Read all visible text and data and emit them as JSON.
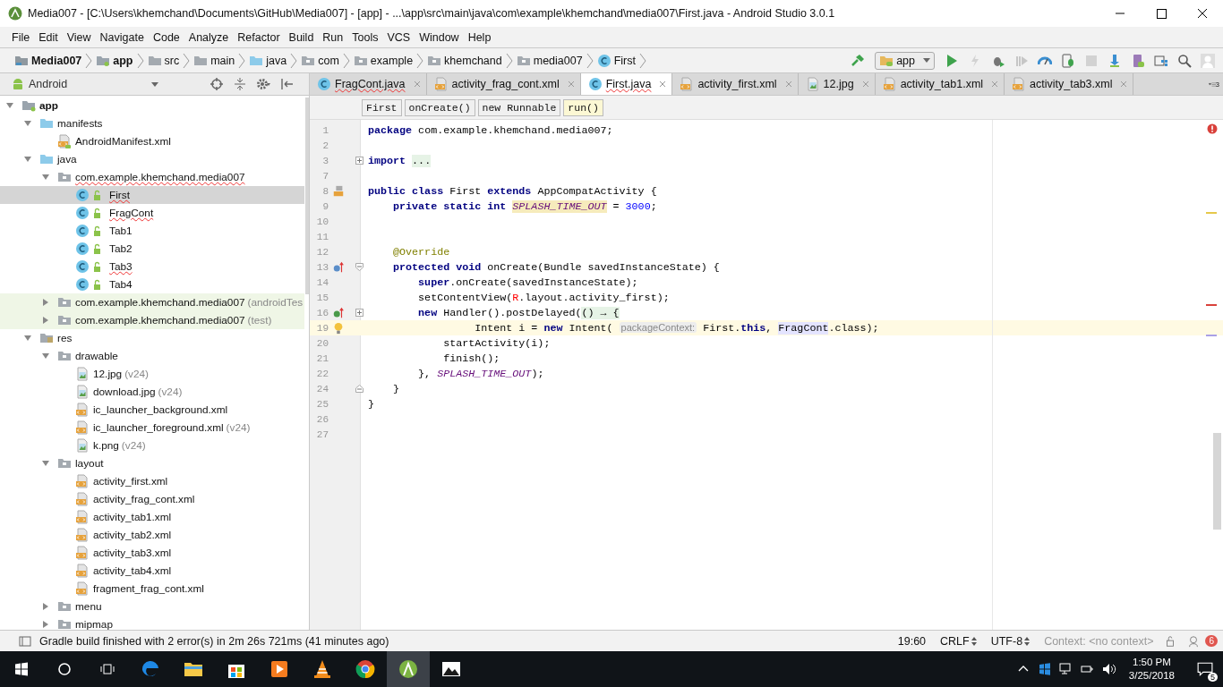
{
  "window": {
    "title": "Media007 - [C:\\Users\\khemchand\\Documents\\GitHub\\Media007] - [app] - ...\\app\\src\\main\\java\\com\\example\\khemchand\\media007\\First.java - Android Studio 3.0.1"
  },
  "menu": [
    "File",
    "Edit",
    "View",
    "Navigate",
    "Code",
    "Analyze",
    "Refactor",
    "Build",
    "Run",
    "Tools",
    "VCS",
    "Window",
    "Help"
  ],
  "breadcrumb": [
    {
      "label": "Media007",
      "kind": "project"
    },
    {
      "label": "app",
      "kind": "module"
    },
    {
      "label": "src",
      "kind": "folder"
    },
    {
      "label": "main",
      "kind": "folder"
    },
    {
      "label": "java",
      "kind": "source"
    },
    {
      "label": "com",
      "kind": "package"
    },
    {
      "label": "example",
      "kind": "package"
    },
    {
      "label": "khemchand",
      "kind": "package"
    },
    {
      "label": "media007",
      "kind": "package"
    },
    {
      "label": "First",
      "kind": "class"
    }
  ],
  "toolbar": [
    {
      "kind": "build",
      "disabled": false
    },
    {
      "kind": "config",
      "label": "app",
      "disabled": false
    },
    {
      "kind": "run",
      "disabled": false
    },
    {
      "kind": "apply",
      "disabled": true
    },
    {
      "kind": "debug",
      "disabled": false
    },
    {
      "kind": "coverage",
      "disabled": true
    },
    {
      "kind": "profile",
      "disabled": false
    },
    {
      "kind": "attach",
      "disabled": false
    },
    {
      "kind": "stop",
      "disabled": true
    },
    {
      "kind": "sdk",
      "disabled": false
    },
    {
      "kind": "avd",
      "disabled": false
    },
    {
      "kind": "structure",
      "disabled": false
    },
    {
      "kind": "search",
      "disabled": false
    },
    {
      "kind": "account",
      "disabled": false
    }
  ],
  "project": {
    "view": "Android",
    "tree": [
      {
        "label": "app",
        "kind": "module",
        "expanded": true,
        "selected": false,
        "children": [
          {
            "label": "manifests",
            "kind": "source",
            "expanded": true,
            "selected": false,
            "children": [
              {
                "label": "AndroidManifest.xml",
                "kind": "manifest",
                "selected": false
              }
            ]
          },
          {
            "label": "java",
            "kind": "source",
            "expanded": true,
            "selected": false,
            "children": [
              {
                "label": "com.example.khemchand.media007",
                "kind": "package",
                "expanded": true,
                "selected": false,
                "error": true,
                "children": [
                  {
                    "label": "First",
                    "kind": "class",
                    "selected": true,
                    "error": true
                  },
                  {
                    "label": "FragCont",
                    "kind": "class",
                    "selected": false,
                    "error": true
                  },
                  {
                    "label": "Tab1",
                    "kind": "class",
                    "selected": false
                  },
                  {
                    "label": "Tab2",
                    "kind": "class",
                    "selected": false
                  },
                  {
                    "label": "Tab3",
                    "kind": "class",
                    "selected": false,
                    "error": true
                  },
                  {
                    "label": "Tab4",
                    "kind": "class",
                    "selected": false
                  }
                ]
              },
              {
                "label": "com.example.khemchand.media007",
                "suffix": "(androidTes",
                "kind": "package",
                "expanded": false,
                "selected": false,
                "test": true
              },
              {
                "label": "com.example.khemchand.media007",
                "suffix": "(test)",
                "kind": "package",
                "expanded": false,
                "selected": false,
                "test": true
              }
            ]
          },
          {
            "label": "res",
            "kind": "res",
            "expanded": true,
            "selected": false,
            "children": [
              {
                "label": "drawable",
                "kind": "package",
                "expanded": true,
                "selected": false,
                "children": [
                  {
                    "label": "12.jpg",
                    "suffix": "(v24)",
                    "kind": "image",
                    "selected": false
                  },
                  {
                    "label": "download.jpg",
                    "suffix": "(v24)",
                    "kind": "image",
                    "selected": false
                  },
                  {
                    "label": "ic_launcher_background.xml",
                    "kind": "xml",
                    "selected": false
                  },
                  {
                    "label": "ic_launcher_foreground.xml",
                    "suffix": "(v24)",
                    "kind": "xml",
                    "selected": false
                  },
                  {
                    "label": "k.png",
                    "suffix": "(v24)",
                    "kind": "image",
                    "selected": false
                  }
                ]
              },
              {
                "label": "layout",
                "kind": "package",
                "expanded": true,
                "selected": false,
                "children": [
                  {
                    "label": "activity_first.xml",
                    "kind": "xml",
                    "selected": false
                  },
                  {
                    "label": "activity_frag_cont.xml",
                    "kind": "xml",
                    "selected": false
                  },
                  {
                    "label": "activity_tab1.xml",
                    "kind": "xml",
                    "selected": false
                  },
                  {
                    "label": "activity_tab2.xml",
                    "kind": "xml",
                    "selected": false
                  },
                  {
                    "label": "activity_tab3.xml",
                    "kind": "xml",
                    "selected": false
                  },
                  {
                    "label": "activity_tab4.xml",
                    "kind": "xml",
                    "selected": false
                  },
                  {
                    "label": "fragment_frag_cont.xml",
                    "kind": "xml",
                    "selected": false
                  }
                ]
              },
              {
                "label": "menu",
                "kind": "package",
                "expanded": false,
                "selected": false
              },
              {
                "label": "mipmap",
                "kind": "package",
                "expanded": false,
                "selected": false
              }
            ]
          }
        ]
      }
    ]
  },
  "tabs": [
    {
      "label": "FragCont.java",
      "kind": "class",
      "selected": false,
      "error": true
    },
    {
      "label": "activity_frag_cont.xml",
      "kind": "xml",
      "selected": false,
      "error": false
    },
    {
      "label": "First.java",
      "kind": "class",
      "selected": true,
      "error": true
    },
    {
      "label": "activity_first.xml",
      "kind": "xml",
      "selected": false,
      "error": false
    },
    {
      "label": "12.jpg",
      "kind": "image",
      "selected": false,
      "error": false
    },
    {
      "label": "activity_tab1.xml",
      "kind": "xml",
      "selected": false,
      "error": false
    },
    {
      "label": "activity_tab3.xml",
      "kind": "xml",
      "selected": false,
      "error": false
    }
  ],
  "tabs_overflow": "3",
  "scope": [
    {
      "label": "First",
      "selected": false
    },
    {
      "label": "onCreate()",
      "selected": false
    },
    {
      "label": "new Runnable",
      "selected": false
    },
    {
      "label": "run()",
      "selected": true
    }
  ],
  "code": [
    {
      "num": "1",
      "tokens": [
        {
          "kind": "kw",
          "t": "package"
        },
        {
          "kind": "txt",
          "t": " com.example.khemchand.media007;"
        }
      ]
    },
    {
      "num": "2"
    },
    {
      "num": "3",
      "fold": {
        "kind": "collapsed"
      },
      "tokens": [
        {
          "kind": "kw",
          "t": "import "
        },
        {
          "kind": "folded",
          "t": "..."
        }
      ]
    },
    {
      "num": "7"
    },
    {
      "num": "8",
      "gutter": {
        "kind": "layout"
      },
      "tokens": [
        {
          "kind": "kw",
          "t": "public class "
        },
        {
          "kind": "txt",
          "t": "First "
        },
        {
          "kind": "kw",
          "t": "extends "
        },
        {
          "kind": "txt",
          "t": "AppCompatActivity {"
        }
      ]
    },
    {
      "num": "9",
      "tokens": [
        {
          "kind": "kw",
          "t": "    private static int "
        },
        {
          "kind": "field-hl",
          "t": "SPLASH_TIME_OUT"
        },
        {
          "kind": "txt",
          "t": " = "
        },
        {
          "kind": "num",
          "t": "3000"
        },
        {
          "kind": "txt",
          "t": ";"
        }
      ]
    },
    {
      "num": "10"
    },
    {
      "num": "11"
    },
    {
      "num": "12",
      "tokens": [
        {
          "kind": "annot",
          "t": "    @Override"
        }
      ]
    },
    {
      "num": "13",
      "gutter": {
        "kind": "override"
      },
      "fold": {
        "kind": "open"
      },
      "tokens": [
        {
          "kind": "kw",
          "t": "    protected void "
        },
        {
          "kind": "txt",
          "t": "onCreate(Bundle savedInstanceState) {"
        }
      ]
    },
    {
      "num": "14",
      "tokens": [
        {
          "kind": "kw",
          "t": "        super"
        },
        {
          "kind": "txt",
          "t": ".onCreate(savedInstanceState);"
        }
      ]
    },
    {
      "num": "15",
      "tokens": [
        {
          "kind": "txt",
          "t": "        setContentView("
        },
        {
          "kind": "err",
          "t": "R"
        },
        {
          "kind": "txt",
          "t": ".layout.activity_first);"
        }
      ]
    },
    {
      "num": "16",
      "gutter": {
        "kind": "implement"
      },
      "fold": {
        "kind": "collapsed"
      },
      "tokens": [
        {
          "kind": "kw",
          "t": "        new "
        },
        {
          "kind": "txt",
          "t": "Handler().postDelayed("
        },
        {
          "kind": "folded",
          "t": "() → {"
        }
      ]
    },
    {
      "num": "19",
      "gutter": {
        "kind": "bulb"
      },
      "current": true,
      "tokens": [
        {
          "kind": "txt",
          "t": "                 Intent i = "
        },
        {
          "kind": "kw",
          "t": "new "
        },
        {
          "kind": "txt",
          "t": "Intent( "
        },
        {
          "kind": "hint",
          "t": "packageContext:"
        },
        {
          "kind": "txt",
          "t": " First."
        },
        {
          "kind": "kw",
          "t": "this"
        },
        {
          "kind": "txt",
          "t": ", "
        },
        {
          "kind": "ref",
          "t": "FragCont"
        },
        {
          "kind": "txt",
          "t": ".class);"
        }
      ]
    },
    {
      "num": "20",
      "tokens": [
        {
          "kind": "txt",
          "t": "            startActivity(i);"
        }
      ]
    },
    {
      "num": "21",
      "tokens": [
        {
          "kind": "txt",
          "t": "            finish();"
        }
      ]
    },
    {
      "num": "22",
      "tokens": [
        {
          "kind": "txt",
          "t": "        }, "
        },
        {
          "kind": "field",
          "t": "SPLASH_TIME_OUT"
        },
        {
          "kind": "txt",
          "t": ");"
        }
      ]
    },
    {
      "num": "24",
      "fold": {
        "kind": "end"
      },
      "tokens": [
        {
          "kind": "txt",
          "t": "    }"
        }
      ]
    },
    {
      "num": "25",
      "tokens": [
        {
          "kind": "txt",
          "t": "}"
        }
      ]
    },
    {
      "num": "26"
    },
    {
      "num": "27"
    }
  ],
  "status_bar": {
    "message": "Gradle build finished with 2 error(s) in 2m 26s 721ms (41 minutes ago)",
    "position": "19:60",
    "line_separator": "CRLF",
    "encoding": "UTF-8",
    "context": "Context: <no context>",
    "errors": "6"
  },
  "taskbar": {
    "apps": [
      {
        "kind": "edge",
        "active": false
      },
      {
        "kind": "explorer",
        "active": false
      },
      {
        "kind": "store",
        "active": false
      },
      {
        "kind": "media",
        "active": false
      },
      {
        "kind": "vlc",
        "active": false
      },
      {
        "kind": "chrome",
        "active": false
      },
      {
        "kind": "studio",
        "active": true
      },
      {
        "kind": "photos",
        "active": false
      }
    ],
    "time": "1:50 PM",
    "date": "3/25/2018",
    "notifications": "5"
  }
}
